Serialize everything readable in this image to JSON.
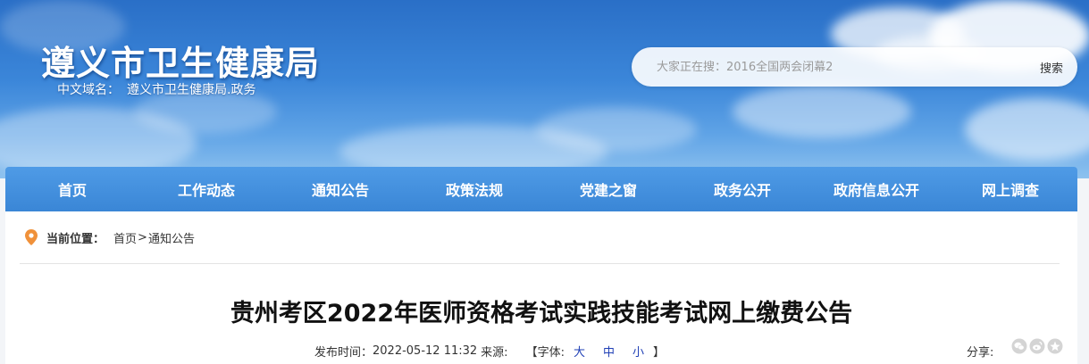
{
  "header": {
    "site_title": "遵义市卫生健康局",
    "domain_label": "中文域名：",
    "domain_value": "遵义市卫生健康局.政务"
  },
  "search": {
    "placeholder": "大家正在搜：2016全国两会闭幕2",
    "button_label": "搜索"
  },
  "nav": {
    "items": [
      {
        "label": "首页"
      },
      {
        "label": "工作动态"
      },
      {
        "label": "通知公告"
      },
      {
        "label": "政策法规"
      },
      {
        "label": "党建之窗"
      },
      {
        "label": "政务公开"
      },
      {
        "label": "政府信息公开"
      },
      {
        "label": "网上调查"
      }
    ]
  },
  "breadcrumb": {
    "label": "当前位置：",
    "items": [
      "首页",
      "通知公告"
    ],
    "separator": ">"
  },
  "article": {
    "title": "贵州考区2022年医师资格考试实践技能考试网上缴费公告",
    "publish_label": "发布时间：",
    "publish_time": "2022-05-12 11:32",
    "source_label": "来源:",
    "font_label": "【字体:",
    "font_large": "大",
    "font_medium": "中",
    "font_small": "小",
    "font_end": "】",
    "share_label": "分享:"
  },
  "icons": {
    "location": "location-pin-icon",
    "share": [
      "wechat-icon",
      "weibo-icon",
      "qzone-icon"
    ]
  },
  "colors": {
    "nav_bg": "#3a86d6",
    "font_link": "#1f3fb5",
    "location_icon": "#f0913a"
  }
}
